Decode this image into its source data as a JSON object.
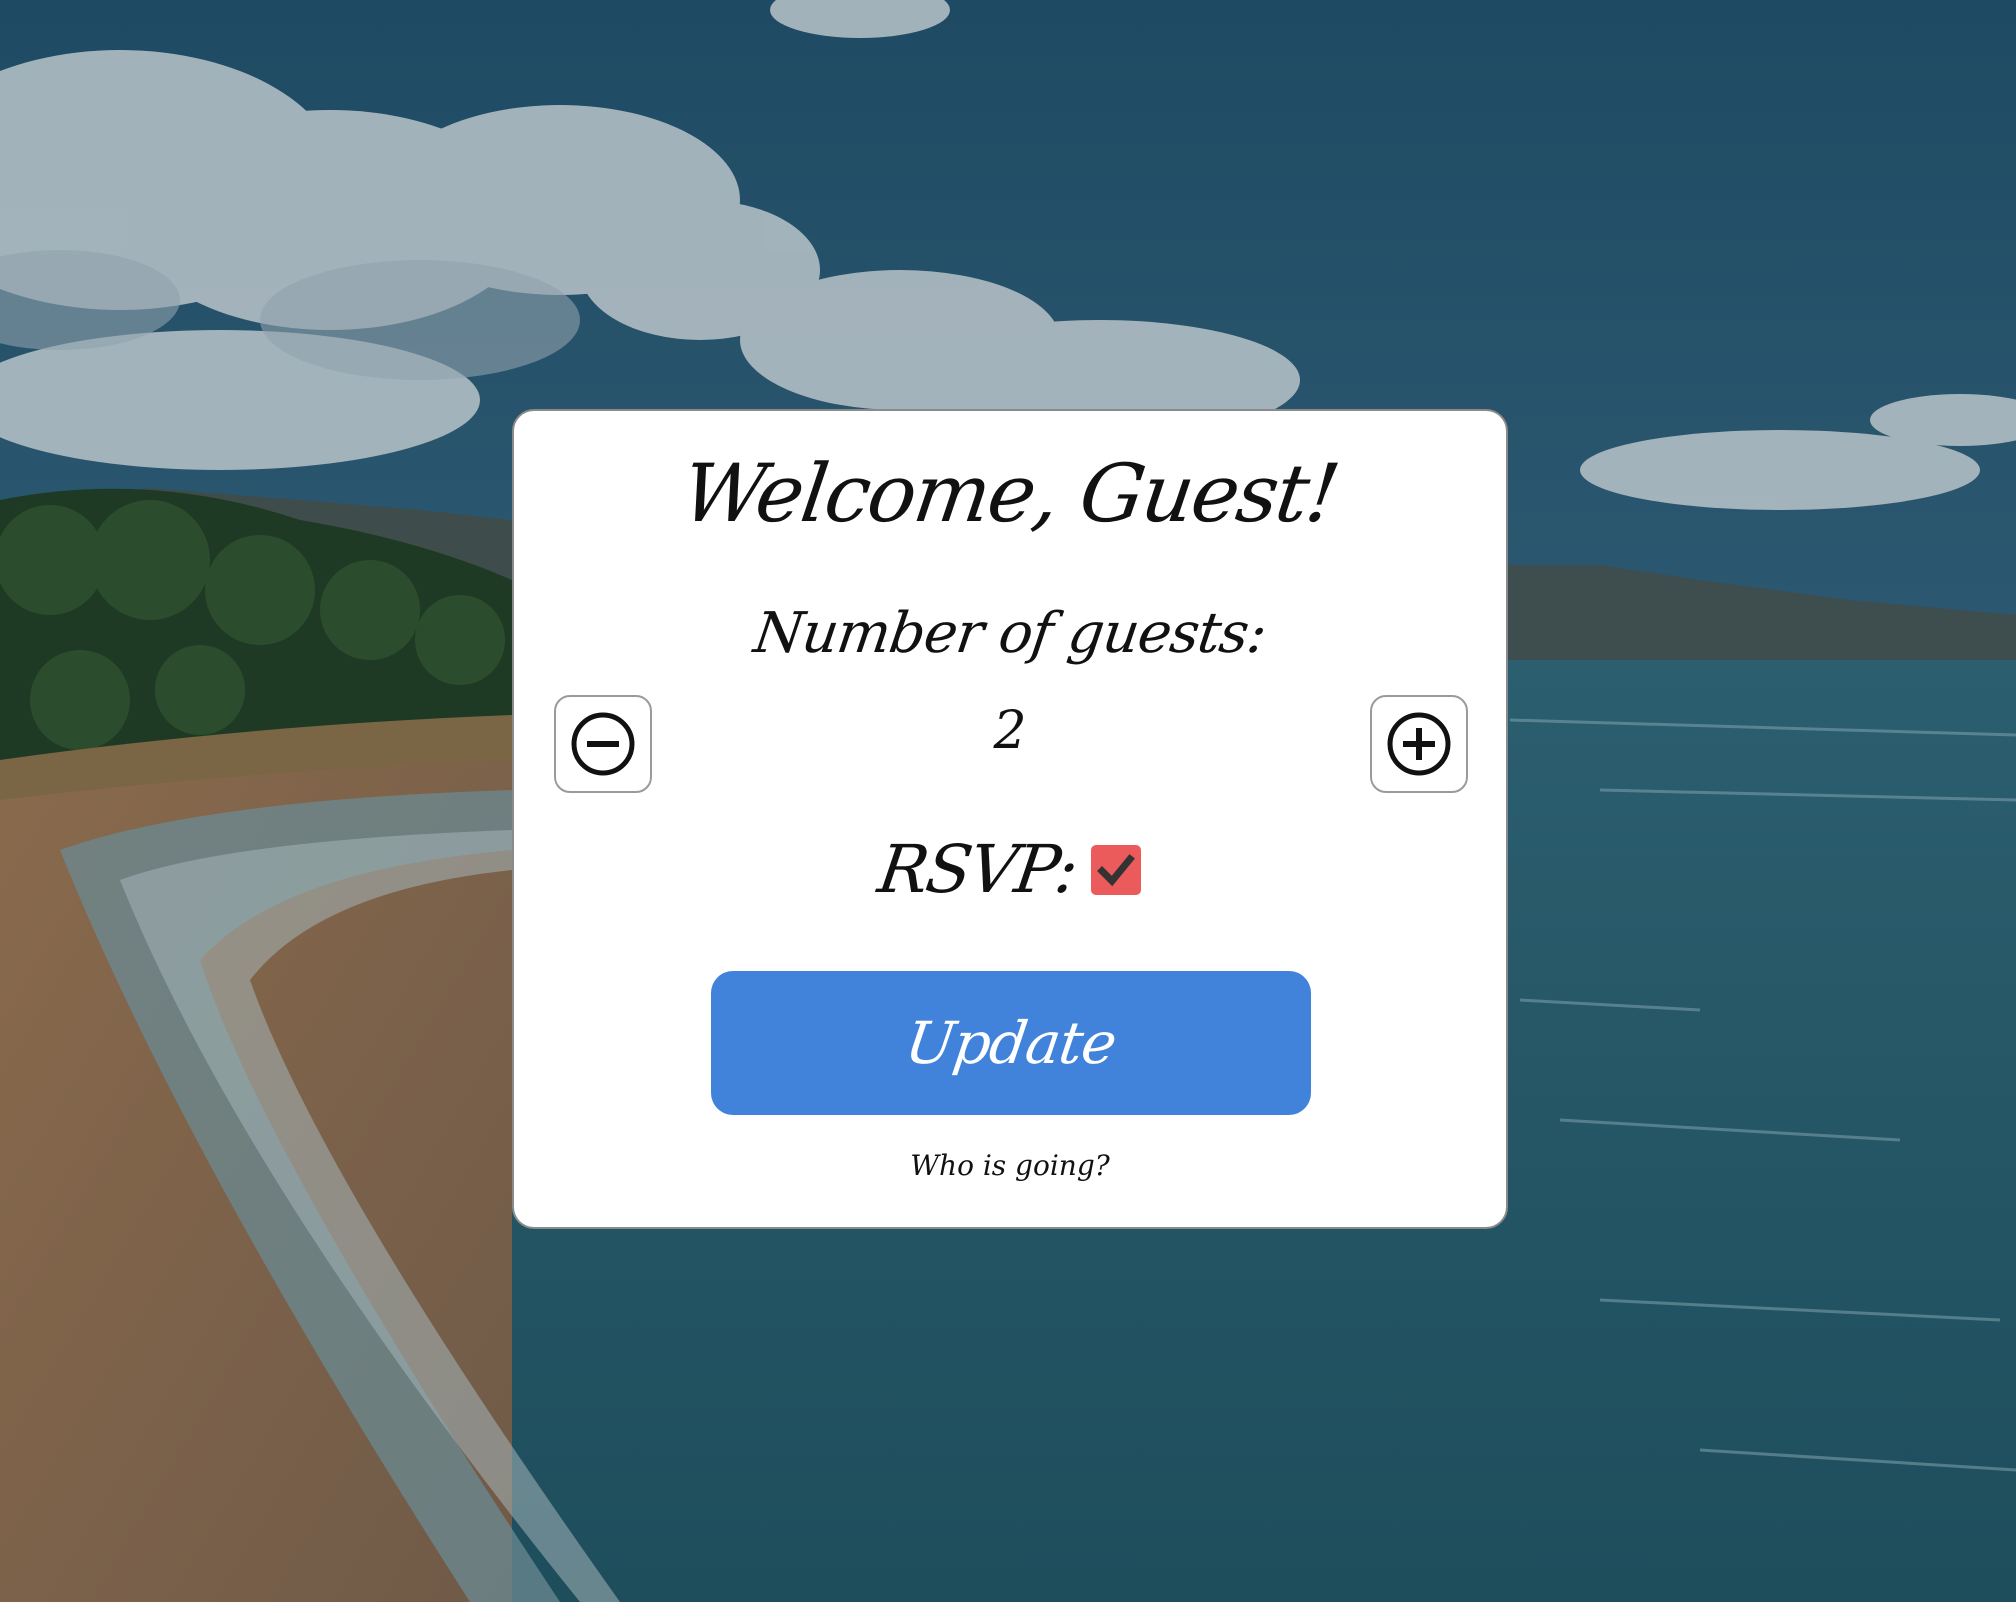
{
  "card": {
    "title": "Welcome, Guest!",
    "guests_label": "Number of guests:",
    "guest_count": "2",
    "decrement_icon": "minus-circle-icon",
    "increment_icon": "plus-circle-icon",
    "rsvp_label": "RSVP:",
    "rsvp_checked": true,
    "update_label": "Update",
    "who_link": "Who is going?"
  },
  "colors": {
    "card_background": "#ffffff",
    "accent_button": "#4183db",
    "checkbox": "#ec5b5b",
    "checkmark": "#333333",
    "text": "#111111"
  }
}
